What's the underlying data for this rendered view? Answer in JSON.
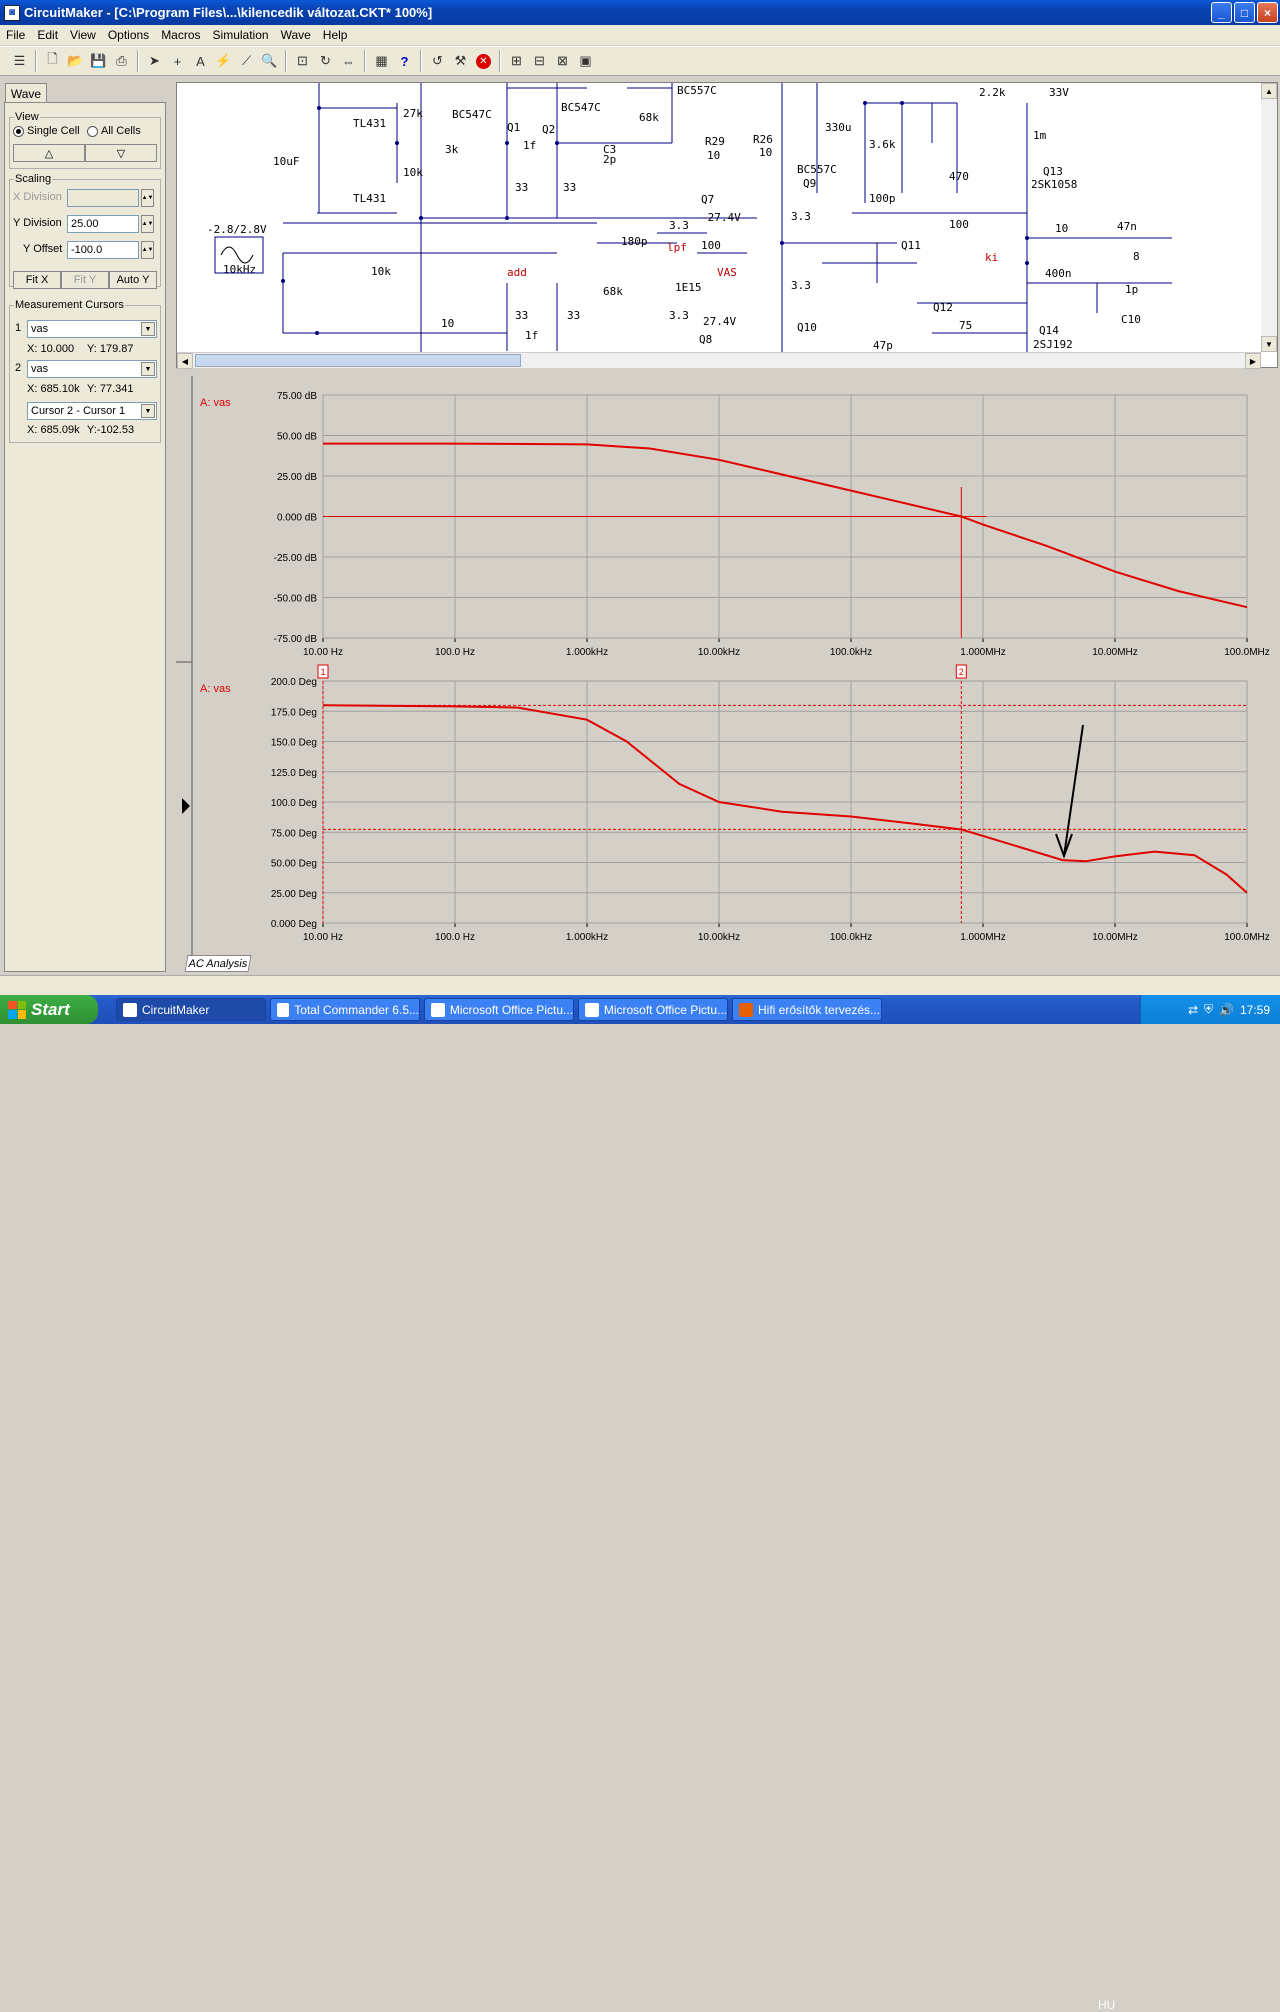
{
  "window": {
    "title": "CircuitMaker - [C:\\Program Files\\...\\kilencedik változat.CKT* 100%]",
    "minimize": "_",
    "maximize": "□",
    "close": "×"
  },
  "menu": [
    "File",
    "Edit",
    "View",
    "Options",
    "Macros",
    "Simulation",
    "Wave",
    "Help"
  ],
  "toolbar_icons": [
    "wire-tool-icon",
    "new-file-icon",
    "open-file-icon",
    "save-icon",
    "print-icon",
    "arrow-select-icon",
    "crosshair-icon",
    "text-tool-icon",
    "probe-icon",
    "wire-icon",
    "zoom-icon",
    "zoom-fit-icon",
    "rotate-icon",
    "flip-icon",
    "netlist-icon",
    "help-icon",
    "undo-icon",
    "tool-icon",
    "stop-icon",
    "digital-mode-icon",
    "analog-mode-icon",
    "trace-icon",
    "run-icon"
  ],
  "left_panel": {
    "tab": "Wave",
    "view": {
      "legend": "View",
      "single_cell": "Single Cell",
      "all_cells": "All Cells",
      "up": "△",
      "down": "▽"
    },
    "scaling": {
      "legend": "Scaling",
      "x_division_label": "X Division",
      "x_division_value": "",
      "y_division_label": "Y Division",
      "y_division_value": "25.00",
      "y_offset_label": "Y Offset",
      "y_offset_value": "-100.0",
      "fit_x": "Fit X",
      "fit_y": "Fit Y",
      "auto_y": "Auto Y"
    },
    "cursors": {
      "legend": "Measurement Cursors",
      "c1_num": "1",
      "c1_sel": "vas",
      "c1_x": "X: 10.000",
      "c1_y": "Y: 179.87",
      "c2_num": "2",
      "c2_sel": "vas",
      "c2_x": "X: 685.10k",
      "c2_y": "Y: 77.341",
      "diff_sel": "Cursor 2 - Cursor 1",
      "diff_x": "X: 685.09k",
      "diff_y": "Y:-102.53"
    }
  },
  "schematic": {
    "labels": [
      "BC557C",
      "BC547C",
      "BC547C",
      "Q1",
      "Q2",
      "TL431",
      "TL431",
      "27k",
      "10k",
      "3k",
      "10uF",
      "1f",
      "C3",
      "2p",
      "68k",
      "33",
      "33",
      "R29",
      "10",
      "R26",
      "10",
      "Q7",
      "-27.4V",
      "3.3",
      "BC557C",
      "Q9",
      "3.3",
      "180p",
      "lpf",
      "100",
      "VAS",
      "add",
      "10k",
      "68k",
      "1E15",
      "3.3",
      "27.4V",
      "Q8",
      "10",
      "33",
      "33",
      "1f",
      "3.3",
      "Q10",
      "330u",
      "3.6k",
      "2.2k",
      "33V",
      "1m",
      "470",
      "100p",
      "100",
      "Q13",
      "2SK1058",
      "10",
      "47n",
      "Q11",
      "ki",
      "400n",
      "8",
      "1p",
      "C10",
      "Q12",
      "75",
      "Q14",
      "2SJ192",
      "47p"
    ],
    "source_label": "-2.8/2.8V",
    "source_freq": "10kHz"
  },
  "plot1": {
    "trace_label": "A: vas",
    "y_ticks": [
      "75.00 dB",
      "50.00 dB",
      "25.00 dB",
      "0.000 dB",
      "-25.00 dB",
      "-50.00 dB",
      "-75.00 dB"
    ],
    "x_ticks": [
      "10.00 Hz",
      "100.0 Hz",
      "1.000kHz",
      "10.00kHz",
      "100.0kHz",
      "1.000MHz",
      "10.00MHz",
      "100.0MHz"
    ]
  },
  "plot2": {
    "trace_label": "A: vas",
    "y_ticks": [
      "200.0 Deg",
      "175.0 Deg",
      "150.0 Deg",
      "125.0 Deg",
      "100.0 Deg",
      "75.00 Deg",
      "50.00 Deg",
      "25.00 Deg",
      "0.000 Deg"
    ],
    "x_ticks": [
      "10.00 Hz",
      "100.0 Hz",
      "1.000kHz",
      "10.00kHz",
      "100.0kHz",
      "1.000MHz",
      "10.00MHz",
      "100.0MHz"
    ],
    "cursor1_tag": "1",
    "cursor2_tag": "2"
  },
  "bottom_tab": "AC Analysis",
  "chart_data": [
    {
      "type": "line",
      "series": [
        {
          "values_note": "",
          "x": [
            10,
            100,
            1000,
            3000,
            10000,
            100000,
            685100,
            1000000,
            3000000,
            10000000,
            30000000,
            100000000
          ],
          "values": [
            45,
            45,
            44.5,
            42,
            35,
            16,
            0,
            -5,
            -18,
            -34,
            -46,
            -56
          ]
        }
      ],
      "xlabel": "",
      "ylabel": "",
      "xlim": [
        10,
        100000000
      ],
      "ylim": [
        -75,
        75
      ],
      "xscale": "log",
      "grid": true
    },
    {
      "type": "line",
      "series": [
        {
          "x": [
            10,
            100,
            300,
            1000,
            2000,
            5000,
            10000,
            30000,
            100000,
            300000,
            685100,
            1000000,
            2000000,
            4000000,
            6000000,
            10000000,
            20000000,
            40000000,
            70000000,
            100000000
          ],
          "values": [
            180,
            179,
            178,
            168,
            150,
            115,
            100,
            92,
            88,
            82,
            77.3,
            72,
            62,
            52,
            51,
            55,
            59,
            56,
            40,
            25
          ]
        }
      ],
      "xlabel": "",
      "ylabel": "",
      "xlim": [
        10,
        100000000
      ],
      "ylim": [
        0,
        200
      ],
      "xscale": "log",
      "grid": true,
      "cursors": [
        {
          "x": 10,
          "y": 179.87
        },
        {
          "x": 685100,
          "y": 77.341
        }
      ]
    }
  ],
  "taskbar": {
    "start": "Start",
    "tasks": [
      "CircuitMaker",
      "Total Commander 6.5...",
      "Microsoft Office Pictu...",
      "Microsoft Office Pictu...",
      "Hifi erősítők tervezés..."
    ],
    "lang": "HU",
    "clock": "17:59"
  },
  "colors": {
    "trace": "#e00000",
    "grid": "#a0a0a0",
    "plot_bg": "#d4d0c8",
    "wire": "#000080",
    "label_red": "#c00000"
  }
}
